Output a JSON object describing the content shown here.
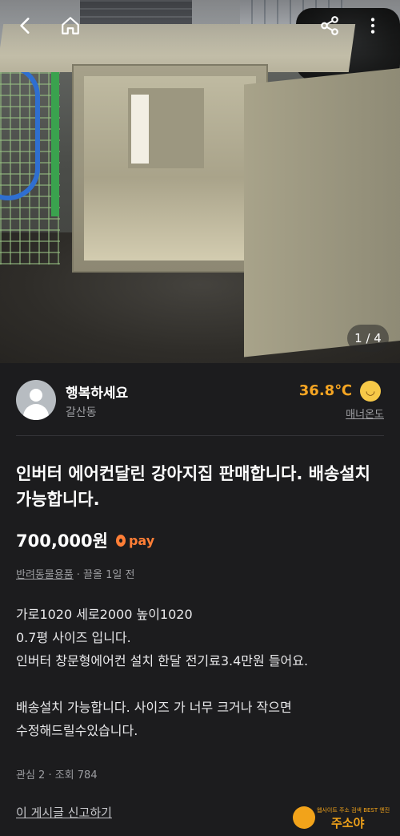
{
  "topbar": {
    "back_icon": "back-arrow-icon",
    "home_icon": "home-icon",
    "share_icon": "share-icon",
    "more_icon": "more-vertical-icon"
  },
  "photo": {
    "current": 1,
    "total": 4,
    "indicator": "1 / 4"
  },
  "seller": {
    "name": "행복하세요",
    "location": "갈산동",
    "temperature": "36.8℃",
    "manner_label": "매너온도",
    "temperature_color": "#f5a523"
  },
  "listing": {
    "title": "인버터 에어컨달린 강아지집 판매합니다. 배송설치 가능합니다.",
    "price": "700,000원",
    "pay_label": "pay",
    "category": "반려동물용품",
    "bumped": "· 끌올 1일 전",
    "description": [
      "가로1020 세로2000 높이1020",
      "0.7평 사이즈 입니다.",
      "인버터 창문형에어컨 설치 한달 전기료3.4만원 들어요.",
      "",
      "배송설치 가능합니다. 사이즈 가 너무 크거나 작으면",
      "수정해드릴수있습니다."
    ],
    "stats": "관심 2 · 조회 784",
    "report": "이 게시글 신고하기"
  },
  "watermark": {
    "small": "웹사이트 주소 검색 BEST 엔진",
    "big": "주소야"
  },
  "colors": {
    "background": "#1c1c1e",
    "accent": "#ff7e36",
    "muted": "#9d9ea2"
  }
}
